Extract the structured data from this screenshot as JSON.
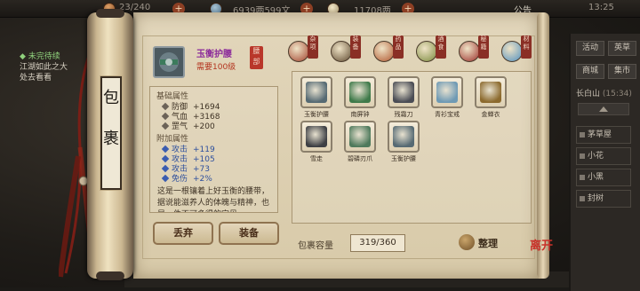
{
  "topbar": {
    "energy": "23/240",
    "currency": "6939两599文",
    "silver": "11708两",
    "announcement": "公告",
    "time": "13:25"
  },
  "quest": {
    "title": "◆ 未完待续",
    "line1": "江湖如此之大",
    "line2": "处去看看"
  },
  "scroll": {
    "vertical_title_1": "包",
    "vertical_title_2": "裹"
  },
  "item_detail": {
    "name": "玉衡护腰",
    "requirement": "需要100级",
    "stamp": "腰部",
    "base_heading": "基础属性",
    "base_attrs": [
      {
        "label": "防御",
        "value": "+1694"
      },
      {
        "label": "气血",
        "value": "+3168"
      },
      {
        "label": "罡气",
        "value": "+200"
      }
    ],
    "extra_heading": "附加属性",
    "extra_attrs": [
      {
        "label": "攻击",
        "value": "+119"
      },
      {
        "label": "攻击",
        "value": "+105"
      },
      {
        "label": "攻击",
        "value": "+73"
      },
      {
        "label": "免伤",
        "value": "+2%"
      }
    ],
    "description": "这是一根镶着上好玉衡的腰带，据说能滋养人的体魄与精神，也是一件不可多得的宝贝。"
  },
  "buttons": {
    "discard": "丢弃",
    "equip": "装备",
    "sort": "整理"
  },
  "tabs": [
    {
      "label": "杂项",
      "color": "#a2432e"
    },
    {
      "label": "装备",
      "color": "#5f4a30"
    },
    {
      "label": "药品",
      "color": "#b0562e"
    },
    {
      "label": "酒食",
      "color": "#7b8a3d"
    },
    {
      "label": "秘籍",
      "color": "#9b2f2b"
    },
    {
      "label": "材料",
      "color": "#4f8fbf"
    }
  ],
  "inventory": [
    {
      "name": "玉衡护腰",
      "color": "#566a73",
      "icon": "belt-icon"
    },
    {
      "name": "南屏钟",
      "color": "#3f7a4a",
      "icon": "bell-icon"
    },
    {
      "name": "残霜刀",
      "color": "#4b4d55",
      "icon": "saber-icon"
    },
    {
      "name": "青衫宝戒",
      "color": "#6f9ab4",
      "icon": "ring-icon"
    },
    {
      "name": "金蝉衣",
      "color": "#8c6a2e",
      "icon": "armor-icon"
    },
    {
      "name": "雪走",
      "color": "#3d3f44",
      "icon": "blade-icon"
    },
    {
      "name": "碧磷刃爪",
      "color": "#4f7a5c",
      "icon": "claw-icon"
    },
    {
      "name": "玉衡护腰",
      "color": "#566a73",
      "icon": "belt-icon"
    }
  ],
  "capacity": {
    "label": "包裹容量",
    "value": "319/360"
  },
  "sidebar": {
    "btn_activity": "活动",
    "btn_rank": "英草",
    "btn_shop": "商城",
    "btn_mail": "集市",
    "location": "长白山",
    "location_time": "(15:34)",
    "players": [
      "茅草屋",
      "小花",
      "小黑",
      "封树"
    ]
  },
  "logo": {
    "text": "离开"
  }
}
